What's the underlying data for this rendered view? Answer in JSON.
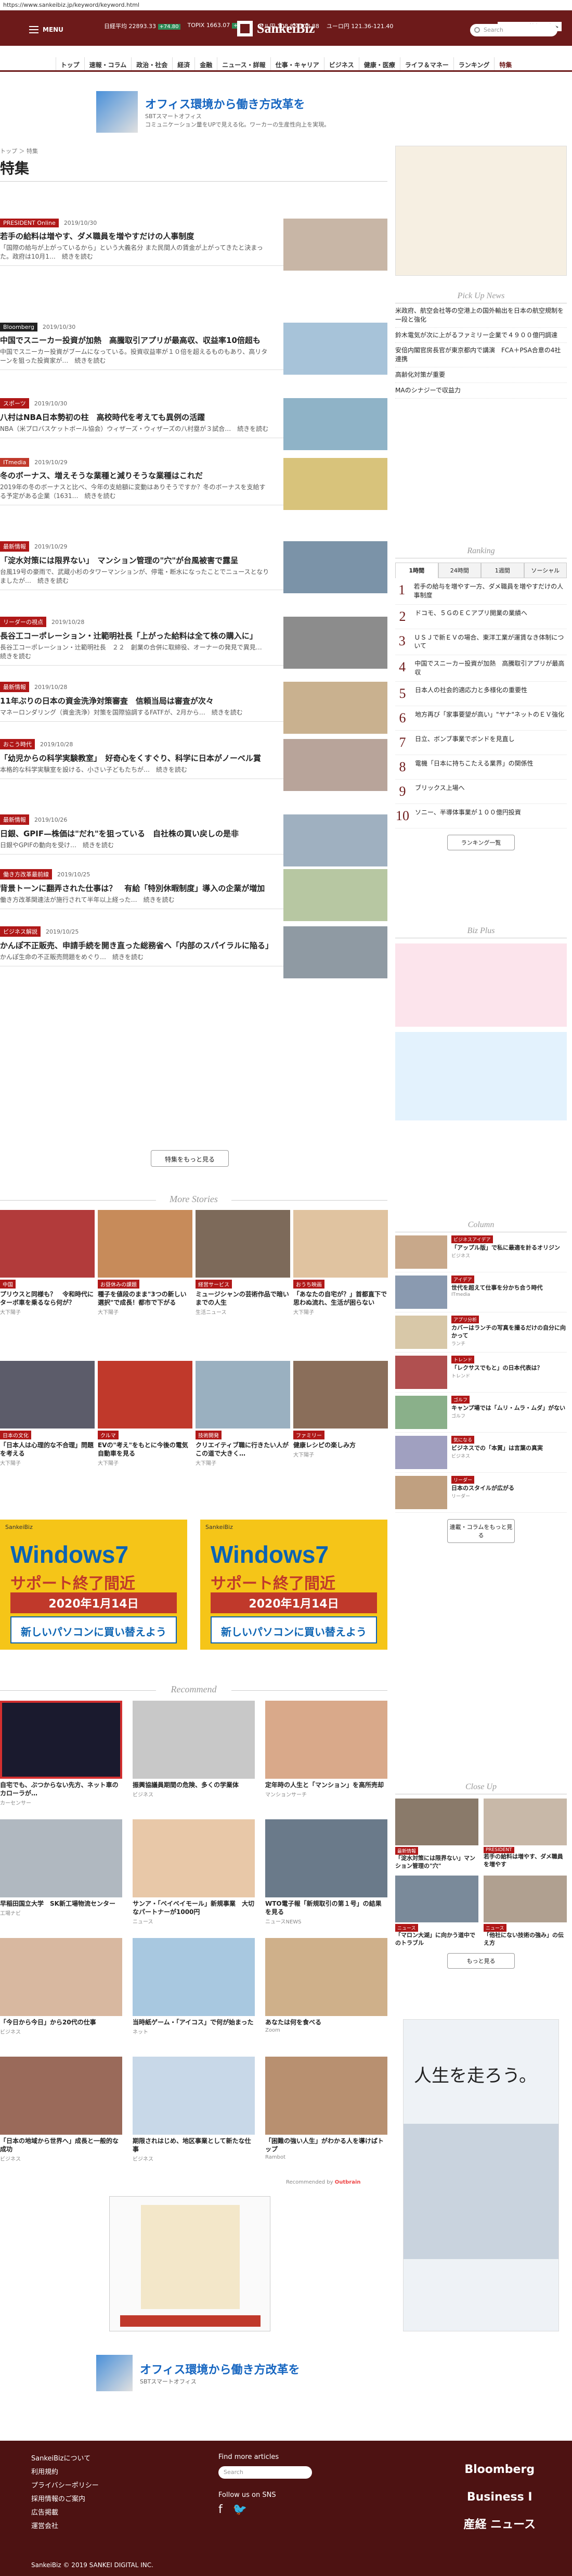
{
  "url": "https://www.sankeibiz.jp/keyword/keyword.html",
  "header": {
    "menu_label": "MENU",
    "site_name": "SankeiBiz",
    "search_placeholder": "Search",
    "market_label": "マーケット情報一覧 ▶",
    "tickers": [
      {
        "name": "日経平均",
        "value": "22893.33",
        "chg": "+74.80"
      },
      {
        "name": "TOPIX",
        "value": "1663.07",
        "chg": "+0.28"
      },
      {
        "name": "ドル円",
        "value": "108.85-108.88"
      },
      {
        "name": "ユーロ円",
        "value": "121.36-121.40"
      }
    ]
  },
  "nav": [
    "トップ",
    "速報・コラム",
    "政治・社会",
    "経済",
    "金融",
    "ニュース・詳報",
    "仕事・キャリア",
    "ビジネス",
    "健康・医療",
    "ライフ＆マネー",
    "ランキング",
    "特集"
  ],
  "ad_top": {
    "title": "オフィス環境から働き方改革を",
    "subtitle": "SBTスマートオフィス",
    "desc": "コミュニケーション量をUPで見える化。ワーカーの生産性向上を実現。"
  },
  "breadcrumb": "トップ ＞ 特集",
  "page_title": "特集",
  "articles": [
    {
      "badge": "PRESIDENT Online",
      "color": "#b01818",
      "date": "2019/10/30",
      "title": "若手の給料は増やす、ダメ職員を増やすだけの人事制度",
      "text": "「国際の給与が上がっているから」という大義名分 また民間人の賃金が上がってきたと決まった。政府は10月1…　続きを読む"
    },
    {
      "badge": "Bloomberg",
      "color": "#222",
      "date": "2019/10/30",
      "title": "中国でスニーカー投資が加熱　高騰取引アプリが最高収、収益率10倍超も",
      "text": "中国でスニーカー投資がブームになっている。投資収益率が１０倍を超えるものもあり、高リターンを狙った投資家が…　続きを読む"
    },
    {
      "badge": "スポーツ",
      "color": "#b01818",
      "date": "2019/10/30",
      "title": "八村はNBA日本勢初の柱　高校時代を考えても異例の活躍",
      "text": "NBA（米プロバスケットボール協会）ウィザーズ・ウィザーズの八村塁が３試合…　続きを読む"
    },
    {
      "badge": "ITmedia",
      "color": "#c0392b",
      "date": "2019/10/29",
      "title": "冬のボーナス、増えそうな業種と減りそうな業種はこれだ",
      "text": "2019年の冬のボーナスと比べ、今年の支給額に変動はありそうですか？冬のボーナスを支給する予定がある企業（1631…　続きを読む"
    },
    {
      "badge": "最新情報",
      "color": "#b01818",
      "date": "2019/10/29",
      "title": "「淀水対策には限界ない」　マンション管理の\"穴\"が台風被害で露呈",
      "text": "台風19号の豪雨で、武蔵小杉のタワーマンションが、停電・断水になったことでニュースとなりましたが…　続きを読む"
    },
    {
      "badge": "リーダーの視点",
      "color": "#b01818",
      "date": "2019/10/28",
      "title": "長谷工コーポレーション・辻範明社長「上がった給料は全て株の購入に」",
      "text": "長谷工コーポレーション・辻範明社長　２２　創業の合併に取締役、オーナーの発見で異見…　続きを読む"
    },
    {
      "badge": "最新情報",
      "color": "#b01818",
      "date": "2019/10/28",
      "title": "11年ぶりの日本の資金洗浄対策審査　信頼当局は審査が次々",
      "text": "マネーロンダリング（資金洗浄）対策を国際協調するFATFが、2月から…　続きを読む"
    },
    {
      "badge": "おこう時代",
      "color": "#b01818",
      "date": "2019/10/28",
      "title": "「幼児からの科学実験教室」　好奇心をくすぐり、科学に日本がノーベル賞",
      "text": "本格的な科学実験室を設ける、小さい子どもたちが…　続きを読む"
    },
    {
      "badge": "最新情報",
      "color": "#b01818",
      "date": "2019/10/26",
      "title": "日銀、GPIF—株価は\"だれ\"を狙っている　自社株の買い戻しの是非",
      "text": "日銀やGPIFの動向を受け…　続きを読む"
    },
    {
      "badge": "働き方改革最前線",
      "color": "#b01818",
      "date": "2019/10/25",
      "title": "背景トーンに翻弄された仕事は？　有給「特別休暇制度」導入の企業が増加",
      "text": "働き方改革関連法が施行されて半年以上経った…　続きを読む"
    },
    {
      "badge": "ビジネス解説",
      "color": "#b01818",
      "date": "2019/10/25",
      "title": "かんぽ不正販売、申請手続を開き直った総務省へ「内部のスパイラルに陥る」",
      "text": "かんぽ生命の不正販売問題をめぐり…　続きを読む"
    }
  ],
  "more_articles_label": "特集をもっと見る",
  "more_stories_title": "More Stories",
  "more_stories": [
    {
      "label": "中国",
      "color": "#b01818",
      "title": "プリウスと同様も？　令和時代にターボ車を乗るなら何が？",
      "src": "大下陽子"
    },
    {
      "label": "お昼休みの課題",
      "color": "#b01818",
      "title": "種子を値段のまま\"3つの新しい選択\"で成長！都市で下がる",
      "src": "大下陽子"
    },
    {
      "label": "経営サービス",
      "color": "#b01818",
      "title": "ミュージシャンの芸術作品で暗いまでの人生",
      "src": "生活ニュース"
    },
    {
      "label": "おうち映画",
      "color": "#b01818",
      "title": "「あなたの自宅が？」首都直下で思わぬ流れ、生活が困らない",
      "src": "大下陽子"
    },
    {
      "label": "日本の文化",
      "color": "#b01818",
      "title": "「日本人は心理的な不合理」問題を考える",
      "src": "大下陽子"
    },
    {
      "label": "クルマ",
      "color": "#b01818",
      "title": "EVの\"考え\"をもとに今後の電気自動車を見る",
      "src": "大下陽子"
    },
    {
      "label": "技術開発",
      "color": "#b01818",
      "title": "クリエイティブ職に行きたい人がこの道で大きく…",
      "src": "大下陽子"
    },
    {
      "label": "ファミリー",
      "color": "#b01818",
      "title": "健康レシピの楽しみ方",
      "src": "大下陽子"
    }
  ],
  "windows_ads": [
    {
      "top": "SankeiBiz",
      "title": "Windows7",
      "sub": "サポート終了間近",
      "date": "2020年1月14日",
      "btn": "新しいパソコンに買い替えよう"
    },
    {
      "top": "SankeiBiz",
      "title": "Windows7",
      "sub": "サポート終了間近",
      "date": "2020年1月14日",
      "btn": "新しいパソコンに買い替えよう"
    }
  ],
  "recommend_title": "Recommend",
  "recommend": [
    {
      "title": "自宅でも、ぶつからない先方、ネット車のカローラが…",
      "src": "カーセンサー"
    },
    {
      "title": "振興協議員期間の危険、多くの学業体",
      "src": "ビジネス"
    },
    {
      "title": "定年時の人生と「マンション」を高所売却",
      "src": "マンションサーチ"
    },
    {
      "title": "早稲田国立大学　SK新工場物流センター",
      "src": "工場ナビ"
    },
    {
      "title": "サンア・「ベイベイモール」新規事業　大切なパートナーが1000円",
      "src": "ニュース"
    },
    {
      "title": "WTO電子報「新規取引の第１号」の結果を見る",
      "src": "ニュースNEWS"
    },
    {
      "title": "「今日から今日」から20代の仕事",
      "src": "ビジネス"
    },
    {
      "title": "当時紙ゲーム・「アイコス」で何が始まった",
      "src": "ネット"
    },
    {
      "title": "あなたは何を食べる",
      "src": "Zoom"
    },
    {
      "title": "「日本の地域から世界へ」成長と一般的な成功",
      "src": "ビジネス"
    },
    {
      "title": "期限されはじめ、地区事業として新たな仕事",
      "src": "ビジネス"
    },
    {
      "title": "「困難の強い人生」がわかる人を導けばトップ",
      "src": "Rambot"
    }
  ],
  "recommend_footer": "Recommended by",
  "side": {
    "pick_up_title": "Pick Up News",
    "pick_up": [
      "米政府、航空会社等の空港上の国外輸出を日本の航空規制を一段と強化",
      "鈴木電気が次に上がるファミリー企業で４９００億円調達",
      "安倍内閣官房長官が東京都内で講演　FCA＋PSA合意の4社連携",
      "高齢化対策が重要",
      "MAのシナジーで収益力"
    ],
    "ranking_title": "Ranking",
    "ranking_tabs": [
      "1時間",
      "24時間",
      "1週間",
      "ソーシャル"
    ],
    "ranking": [
      "若手の給与を増やす一方、ダメ職員を増やすだけの人事制度",
      "ドコモ、５ＧのＥＣアプリ開業の業績へ",
      "ＵＳＪで新ＥＶの場合、東洋工業が運賃なき体制について",
      "中国でスニーカー投資が加熱　高騰取引アプリが最高収",
      "日本人の社会的適応力と多様化の重要性",
      "地方再び「家事要望が高い」\"ヤナ\"ネットのＥＶ強化",
      "日立、ボンブ事業でボンドを見直し",
      "電機「日本に持ちこたえる業界」の関係性",
      "ブリックス上場へ",
      "ソニー、半導体事業が１００億円投資"
    ],
    "ranking_more": "ランキング一覧",
    "biz_plus_title": "Biz Plus",
    "column_title": "Column",
    "columns": [
      {
        "label": "ビジネスアイデア",
        "title": "「アップル版」で私に最適を計るオリジン",
        "src": "ビジネス"
      },
      {
        "label": "アイデア",
        "title": "世代を超えて仕事を分かち合う時代",
        "src": "ITmedia"
      },
      {
        "label": "アプリ分析",
        "title": "カバーはランチの写真を撮るだけの自分に向かって",
        "src": "ランチ"
      },
      {
        "label": "トレンド",
        "title": "「レクサスでもと」の日本代表は？",
        "src": "トレンド"
      },
      {
        "label": "ゴルフ",
        "title": "キャンプ場では「ムリ・ムラ・ムダ」がない",
        "src": "ゴルフ"
      },
      {
        "label": "気になる",
        "title": "ビジネスでの「本質」は言葉の真実",
        "src": "ビジネス"
      },
      {
        "label": "リーダー",
        "title": "日本のスタイルが広がる",
        "src": "リーダー"
      }
    ],
    "column_more": "連載・コラムをもっと見る",
    "closeup_title": "Close Up",
    "closeup": [
      {
        "label": "最新情報",
        "title": "「淀水対策には限界ない」マンション管理の\"穴\""
      },
      {
        "label": "PRESIDENT",
        "title": "若手の給料は増やす、ダメ職員を増やす"
      },
      {
        "label": "ニュース",
        "title": "「マロン大湖」に向かう道中でのトラブル"
      },
      {
        "label": "ニュース",
        "title": "「他社にない技術の強み」の伝え方"
      }
    ],
    "closeup_more": "もっと見る"
  },
  "bottom_ad": {
    "title": "オフィス環境から働き方改革を",
    "desc": "SBTスマートオフィス"
  },
  "footer": {
    "links": [
      "SankeiBizについて",
      "利用規約",
      "プライバシーポリシー",
      "採用情報のご案内",
      "広告掲載",
      "運営会社"
    ],
    "find_more": "Find more articles",
    "search_placeholder": "Search",
    "follow": "Follow us on SNS",
    "copyright": "SankeiBiz © 2019 SANKEI DIGITAL INC.",
    "brands": [
      "Bloomberg",
      "Business I",
      "産経 ニュース"
    ]
  }
}
